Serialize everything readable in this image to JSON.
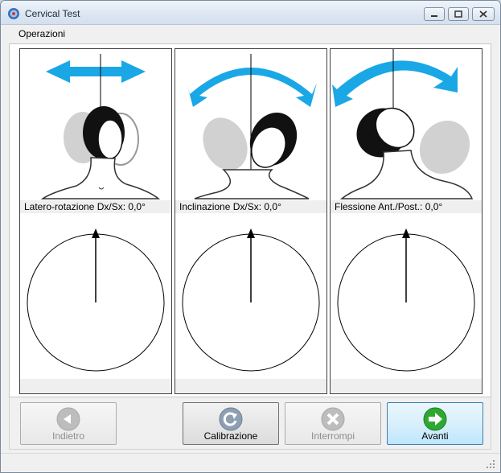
{
  "window": {
    "title": "Cervical Test"
  },
  "menu": {
    "items": [
      {
        "label": "Operazioni"
      }
    ]
  },
  "panels": [
    {
      "label": "Latero-rotazione Dx/Sx: 0,0°",
      "angle_deg": 0.0
    },
    {
      "label": "Inclinazione Dx/Sx: 0,0°",
      "angle_deg": 0.0
    },
    {
      "label": "Flessione Ant./Post.: 0,0°",
      "angle_deg": 0.0
    }
  ],
  "buttons": {
    "back": {
      "label": "Indietro",
      "enabled": false
    },
    "calibrate": {
      "label": "Calibrazione",
      "enabled": true
    },
    "stop": {
      "label": "Interrompi",
      "enabled": false
    },
    "next": {
      "label": "Avanti",
      "enabled": true
    }
  },
  "colors": {
    "accent": "#1aa7e6",
    "next_icon": "#2fa832",
    "disabled_icon": "#b9b9b9",
    "calib_icon": "#7d8fa4"
  }
}
